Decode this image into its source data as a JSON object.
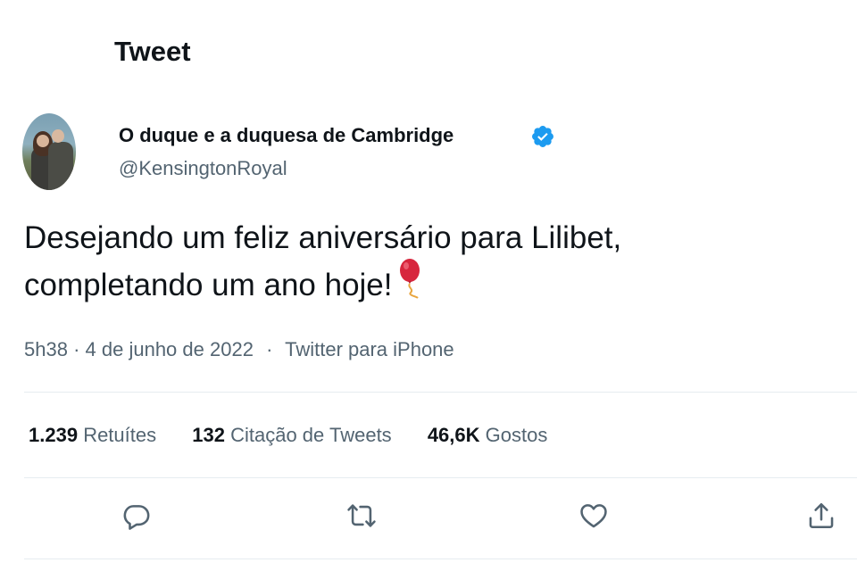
{
  "header": {
    "title": "Tweet"
  },
  "author": {
    "display_name": "O duque e a duquesa de Cambridge",
    "handle": "@KensingtonRoyal",
    "verified": true
  },
  "tweet": {
    "text_line1": "Desejando um feliz aniversário para Lilibet,",
    "text_line2": "completando um ano hoje!",
    "emoji_icon": "balloon-icon",
    "time": "5h38",
    "date": "4 de junho de 2022",
    "separator": "·",
    "source": "Twitter para iPhone"
  },
  "stats": {
    "retweets": {
      "value": "1.239",
      "label": "Retuítes"
    },
    "quotes": {
      "value": "132",
      "label": "Citação de Tweets"
    },
    "likes": {
      "value": "46,6K",
      "label": "Gostos"
    }
  },
  "actions": [
    "reply-icon",
    "retweet-icon",
    "like-icon",
    "share-icon"
  ],
  "colors": {
    "text": "#0f1419",
    "secondary": "#536471",
    "verified": "#1d9bf0",
    "divider": "#e6ecf0"
  }
}
